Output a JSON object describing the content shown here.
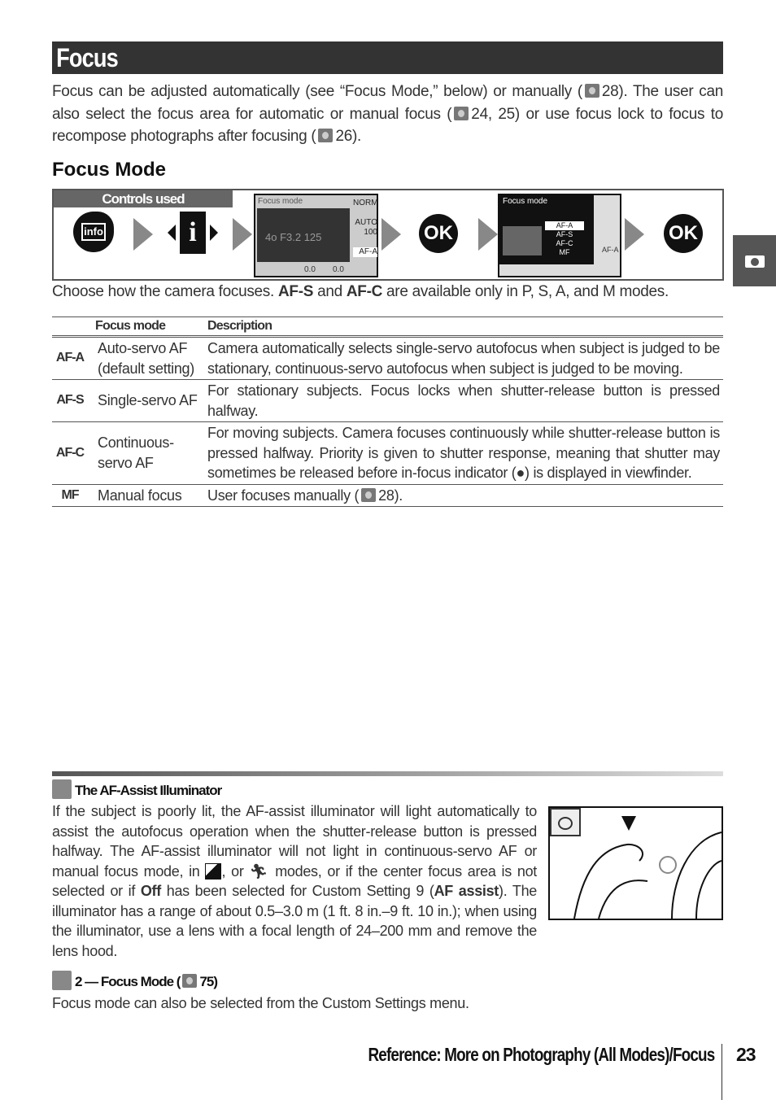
{
  "title": "Focus",
  "intro": {
    "p1": "Focus can be adjusted automatically (see “Focus Mode,” below) or manually (",
    "p1ref": "28).  The user can also select the focus area for automatic or manual focus (",
    "p2ref": "24, 25) or use focus lock to focus to recompose photographs after focusing (",
    "p3ref": "26)."
  },
  "section": "Focus Mode",
  "controls": {
    "label": "Controls used",
    "ok1": "OK",
    "ok2": "OK",
    "screen1": {
      "title": "Focus mode",
      "readout": "4o  F3.2  125",
      "side": [
        "NORM",
        "AUTO",
        "100",
        "AF-A"
      ],
      "bottom": [
        "0.0",
        "0.0"
      ]
    },
    "screen2": {
      "title": "Focus mode",
      "options": [
        "AF-A",
        "AF-S",
        "AF-C",
        "MF"
      ],
      "selected": "AF-A",
      "side": "AF-A"
    }
  },
  "caption": {
    "a": "Choose how the camera focuses.  ",
    "b": "AF-S",
    "c": " and ",
    "d": "AF-C",
    "e": " are available only in ",
    "f": "P, S, A, and M modes."
  },
  "table": {
    "headers": [
      "Focus mode",
      "Description"
    ],
    "rows": [
      {
        "code": "AF-A",
        "name": "Auto-servo AF (default setting)",
        "desc": "Camera automatically selects single-servo autofocus when subject is judged to be stationary, continuous-servo autofocus when subject is judged to be moving."
      },
      {
        "code": "AF-S",
        "name": "Single-servo AF",
        "desc": "For stationary subjects.  Focus locks when shutter-release button is pressed halfway."
      },
      {
        "code": "AF-C",
        "name": "Continuous-servo AF",
        "desc": "For moving subjects.  Camera focuses continuously while shutter-release button is pressed halfway.  Priority is given to shutter response, meaning that shutter may sometimes be released before in-focus indicator (●) is displayed in viewfinder."
      },
      {
        "code": "MF",
        "name": "Manual focus",
        "desc": "User focuses manually (",
        "descref": "28)."
      }
    ]
  },
  "note1": {
    "title": "The AF-Assist Illuminator",
    "t1": "If the subject is poorly lit, the AF-assist illuminator will light automatically to assist the autofocus operation when the shutter-release button is pressed halfway.  The AF-assist illuminator will not light in continuous-servo AF or manual focus mode, in ",
    "t2": ", or ",
    "t3": " modes, or if the center focus area is not selected or if ",
    "b1": "Off",
    "t4": " has been selected for Custom Setting 9 (",
    "b2": "AF assist",
    "t5": ").  The illuminator has a range of about 0.5–3.0 m (1 ft.  8 in.–9 ft. 10 in.); when using the illuminator, use a lens with a focal length of 24–200 mm and remove the lens hood."
  },
  "note2": {
    "title": "2 — Focus Mode (",
    "titleref": "75)",
    "text": "Focus mode can also be selected from the Custom Settings menu."
  },
  "footer": {
    "text": "Reference: More on Photography (All Modes)/Focus",
    "page": "23"
  },
  "icons": {
    "tab": "camera-icon",
    "ref": "book-reference-icon",
    "note1": "magnifier-tip-icon",
    "note2": "pencil-note-icon"
  }
}
